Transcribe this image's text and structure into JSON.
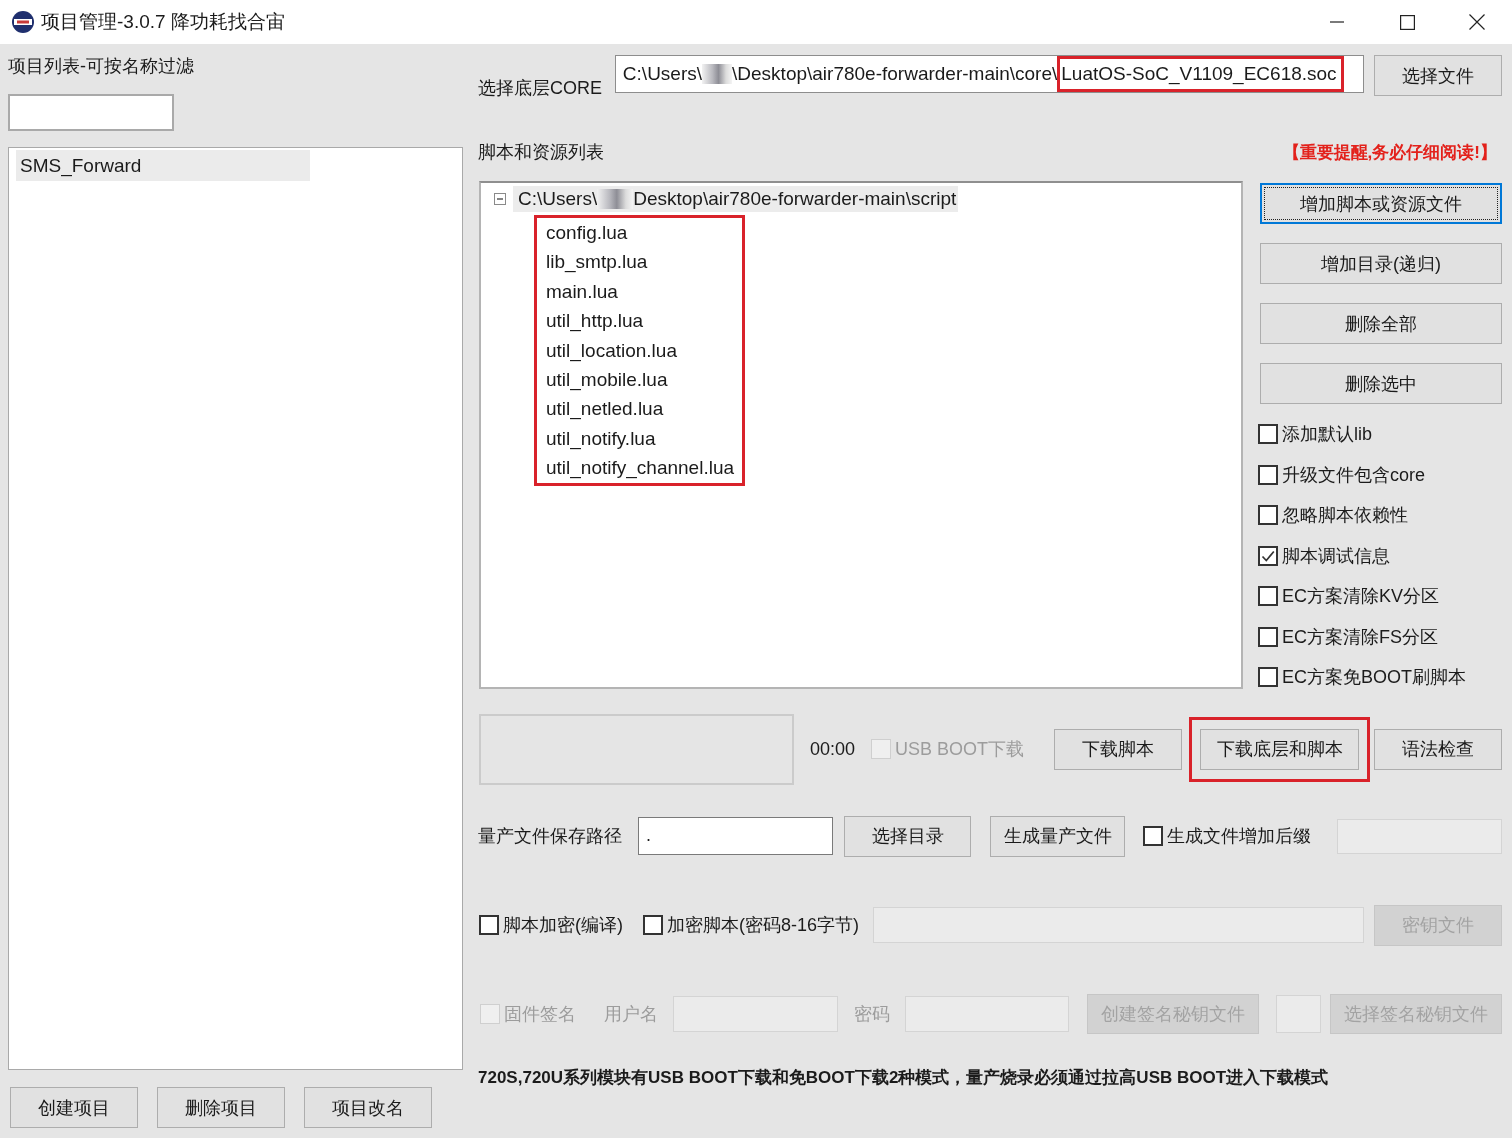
{
  "window": {
    "title": "项目管理-3.0.7 降功耗找合宙"
  },
  "project_panel": {
    "label": "项目列表-可按名称过滤",
    "projects": [
      {
        "name": "SMS_Forward",
        "selected": true
      }
    ],
    "buttons": [
      "创建项目",
      "删除项目",
      "项目改名"
    ]
  },
  "core": {
    "label": "选择底层CORE",
    "path_before": "C:\\Users\\",
    "redacted": true,
    "path_after": "\\Desktop\\air780e-forwarder-main\\core\\",
    "file": "LuatOS-SoC_V1109_EC618.soc",
    "highlighted": true,
    "button": "选择文件"
  },
  "scripts": {
    "label": "脚本和资源列表",
    "notice": "【重要提醒,务必仔细阅读!】",
    "tree": {
      "path_before": "C:\\Users\\",
      "redacted": true,
      "path_after": "Desktop\\air780e-forwarder-main\\script",
      "expanded": true,
      "selected": true,
      "children_highlighted": true,
      "children": [
        {
          "name": "config.lua",
          "selected": false
        },
        {
          "name": "lib_smtp.lua",
          "selected": false
        },
        {
          "name": "main.lua",
          "selected": false
        },
        {
          "name": "util_http.lua",
          "selected": false
        },
        {
          "name": "util_location.lua",
          "selected": false
        },
        {
          "name": "util_mobile.lua",
          "selected": false
        },
        {
          "name": "util_netled.lua",
          "selected": false
        },
        {
          "name": "util_notify.lua",
          "selected": false
        },
        {
          "name": "util_notify_channel.lua",
          "selected": false
        }
      ]
    },
    "buttons": [
      {
        "label": "增加脚本或资源文件",
        "focused": true
      },
      {
        "label": "增加目录(递归)",
        "focused": false
      },
      {
        "label": "删除全部",
        "focused": false
      },
      {
        "label": "删除选中",
        "focused": false
      }
    ],
    "options": [
      {
        "label": "添加默认lib",
        "checked": false
      },
      {
        "label": "升级文件包含core",
        "checked": false
      },
      {
        "label": "忽略脚本依赖性",
        "checked": false
      },
      {
        "label": "脚本调试信息",
        "checked": true
      },
      {
        "label": "EC方案清除KV分区",
        "checked": false
      },
      {
        "label": "EC方案清除FS分区",
        "checked": false
      },
      {
        "label": "EC方案免BOOT刷脚本",
        "checked": false
      }
    ]
  },
  "download": {
    "time": "00:00",
    "usb_boot": {
      "label": "USB BOOT下载",
      "checked": false,
      "disabled": true
    },
    "buttons": [
      {
        "label": "下载脚本",
        "highlighted": false
      },
      {
        "label": "下载底层和脚本",
        "highlighted": true
      },
      {
        "label": "语法检查",
        "highlighted": false
      }
    ]
  },
  "mass_production": {
    "label": "量产文件保存路径",
    "path": ".",
    "buttons": [
      "选择目录",
      "生成量产文件"
    ],
    "suffix_option": {
      "label": "生成文件增加后缀",
      "checked": false
    },
    "suffix_field": {
      "disabled": true
    }
  },
  "encryption": {
    "options": [
      {
        "label": "脚本加密(编译)",
        "checked": false
      },
      {
        "label": "加密脚本(密码8-16字节)",
        "checked": false
      }
    ],
    "password_field": {
      "disabled": true
    },
    "key_button": {
      "label": "密钥文件",
      "disabled": true
    }
  },
  "signing": {
    "checkbox": {
      "label": "固件签名",
      "checked": false,
      "disabled": true
    },
    "username_label": "用户名",
    "username_field": {
      "disabled": true
    },
    "password_label": "密码",
    "password_field": {
      "disabled": true
    },
    "create_button": {
      "label": "创建签名秘钥文件",
      "disabled": true
    },
    "extra_field": {
      "disabled": true
    },
    "select_button": {
      "label": "选择签名秘钥文件",
      "disabled": true
    }
  },
  "note": "720S,720U系列模块有USB BOOT下载和免BOOT下载2种模式，量产烧录必须通过拉高USB BOOT进入下载模式"
}
